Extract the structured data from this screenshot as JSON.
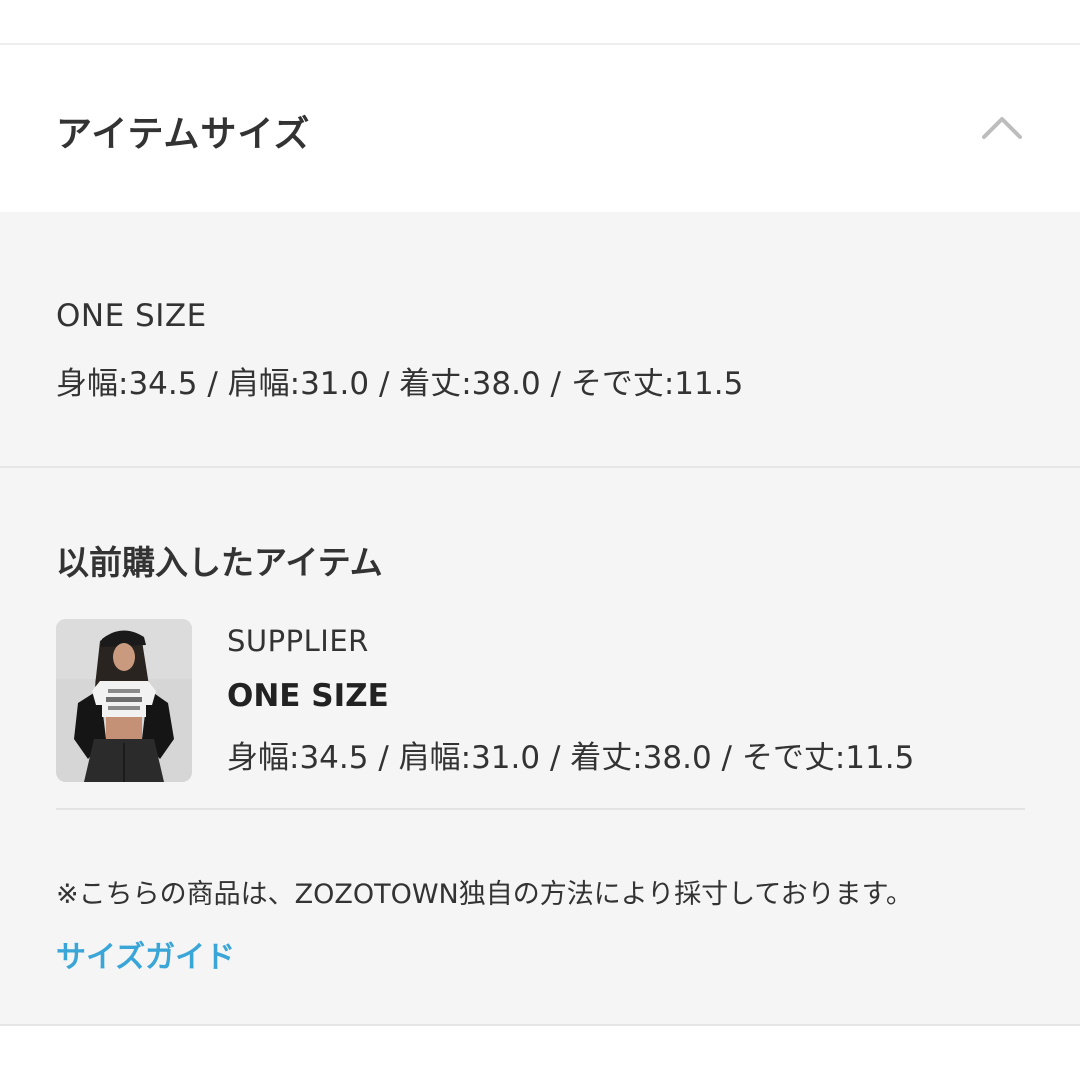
{
  "section": {
    "title": "アイテムサイズ",
    "toggle_icon": "chevron-up-icon"
  },
  "item_size": {
    "size_label": "ONE SIZE",
    "measurements": "身幅:34.5 / 肩幅:31.0 / 着丈:38.0 / そで丈:11.5"
  },
  "previous_purchase": {
    "heading": "以前購入したアイテム",
    "brand": "SUPPLIER",
    "size_label": "ONE SIZE",
    "measurements": "身幅:34.5 / 肩幅:31.0 / 着丈:38.0 / そで丈:11.5"
  },
  "note": "※こちらの商品は、ZOZOTOWN独自の方法により採寸しております。",
  "size_guide_link": "サイズガイド",
  "colors": {
    "link": "#3aa6d8",
    "panel_background": "#f5f5f5",
    "text": "#333333"
  }
}
